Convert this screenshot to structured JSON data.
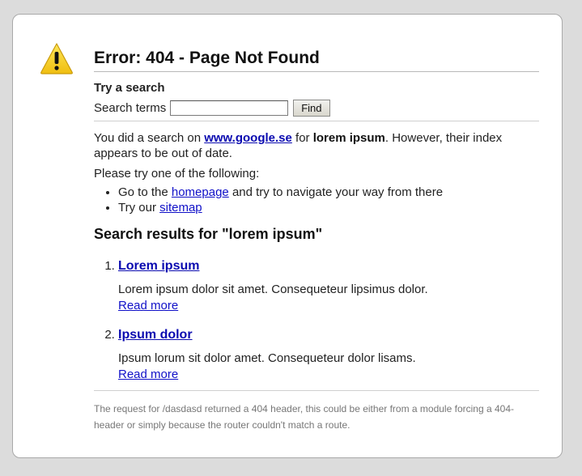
{
  "page": {
    "title": "Error: 404 - Page Not Found"
  },
  "search": {
    "heading": "Try a search",
    "label": "Search terms",
    "input_value": "",
    "button_label": "Find"
  },
  "info": {
    "intro_prefix": "You did a search on ",
    "engine_link": "www.google.se",
    "intro_mid": " for ",
    "query": "lorem ipsum",
    "intro_suffix": ". However, their index appears to be out of date.",
    "please_try": "Please try one of the following:",
    "tips": [
      {
        "prefix": "Go to the ",
        "link": "homepage",
        "suffix": " and try to navigate your way from there"
      },
      {
        "prefix": "Try our ",
        "link": "sitemap",
        "suffix": ""
      }
    ]
  },
  "results": {
    "heading": "Search results for \"lorem ipsum\"",
    "items": [
      {
        "title": "Lorem ipsum",
        "description": "Lorem ipsum dolor sit amet. Consequeteur lipsimus dolor.",
        "read_more": "Read more"
      },
      {
        "title": "Ipsum dolor",
        "description": "Ipsum lorum sit dolor amet. Consequeteur dolor lisams.",
        "read_more": "Read more"
      }
    ]
  },
  "footer": {
    "text": "The request for /dasdasd returned a 404 header, this could be either from a module forcing a 404-header or simply because the router couldn't match a route."
  },
  "icons": {
    "warning": "warning-icon"
  },
  "colors": {
    "link": "#1010c8",
    "warning_fill": "#f7d21c",
    "panel_border": "#a9a9a9",
    "background": "#dcdcdc"
  }
}
